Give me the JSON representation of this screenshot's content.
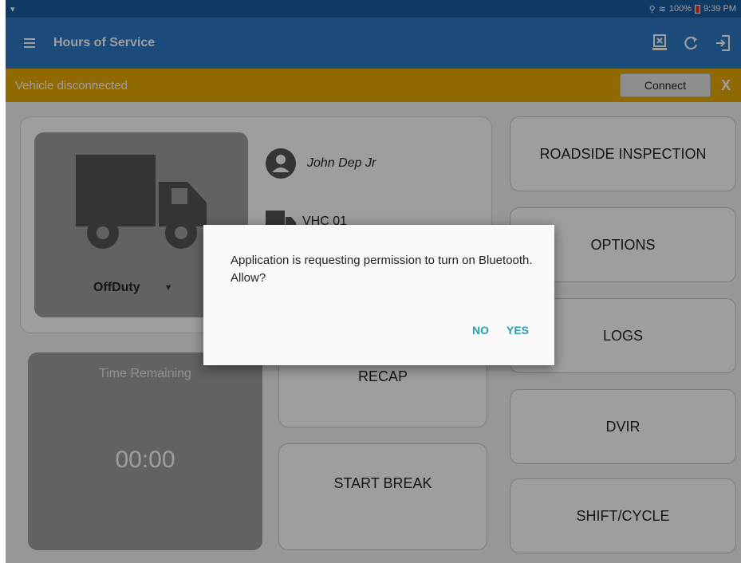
{
  "status_bar": {
    "battery": "100%",
    "time": "9:39 PM",
    "icons": [
      "location-icon",
      "wifi-icon",
      "battery-icon"
    ]
  },
  "app_bar": {
    "title": "Hours of Service",
    "actions": [
      "connect-device-icon",
      "refresh-icon",
      "logout-icon"
    ]
  },
  "banner": {
    "message": "Vehicle disconnected",
    "connect_label": "Connect",
    "close_label": "X",
    "color": "#e9ac00"
  },
  "profile": {
    "driver_name": "John Dep Jr",
    "vehicle_name": "VHC 01",
    "duty_status": "OffDuty"
  },
  "time_remaining": {
    "label": "Time Remaining",
    "value": "00:00"
  },
  "buttons": {
    "recap": "RECAP",
    "start_break": "START BREAK",
    "roadside_inspection": "ROADSIDE INSPECTION",
    "options": "OPTIONS",
    "logs": "LOGS",
    "dvir": "DVIR",
    "shift_cycle": "SHIFT/CYCLE"
  },
  "dialog": {
    "message": "Application is requesting permission to turn on Bluetooth. Allow?",
    "no_label": "NO",
    "yes_label": "YES",
    "accent": "#2a9fb4"
  },
  "colors": {
    "status_bar": "#1b5da0",
    "app_bar": "#2a79c7",
    "tile": "#9e9e9e"
  }
}
